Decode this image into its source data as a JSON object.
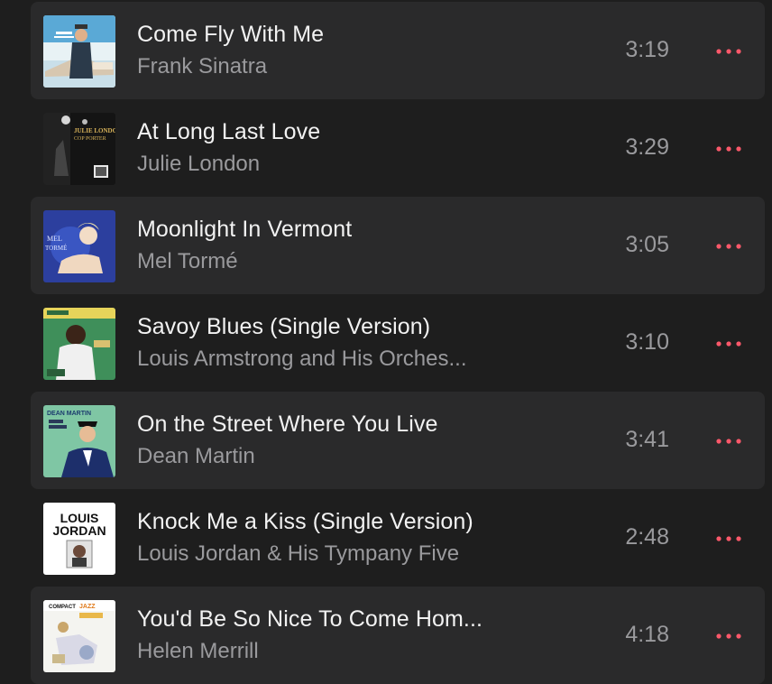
{
  "accent_color": "#fa586a",
  "tracks": [
    {
      "title": "Come Fly With Me",
      "artist": "Frank Sinatra",
      "duration": "3:19"
    },
    {
      "title": "At Long Last Love",
      "artist": "Julie London",
      "duration": "3:29"
    },
    {
      "title": "Moonlight In Vermont",
      "artist": "Mel Tormé",
      "duration": "3:05"
    },
    {
      "title": "Savoy Blues (Single Version)",
      "artist": "Louis Armstrong and His Orches...",
      "duration": "3:10"
    },
    {
      "title": "On the Street Where You Live",
      "artist": "Dean Martin",
      "duration": "3:41"
    },
    {
      "title": "Knock Me a Kiss (Single Version)",
      "artist": "Louis Jordan & His Tympany Five",
      "duration": "2:48"
    },
    {
      "title": "You'd Be So Nice To Come Hom...",
      "artist": "Helen Merrill",
      "duration": "4:18"
    }
  ],
  "artwork_text": {
    "julie_london": "JULIE LONDON",
    "julie_london_sub": "COP PORTER",
    "mel_torme_1": "MEL",
    "mel_torme_2": "TORMÉ",
    "dean_martin": "DEAN MARTIN",
    "louis_jordan_1": "LOUIS",
    "louis_jordan_2": "JORDAN",
    "helen_merrill_1": "COMPACT",
    "helen_merrill_2": "JAZZ"
  }
}
